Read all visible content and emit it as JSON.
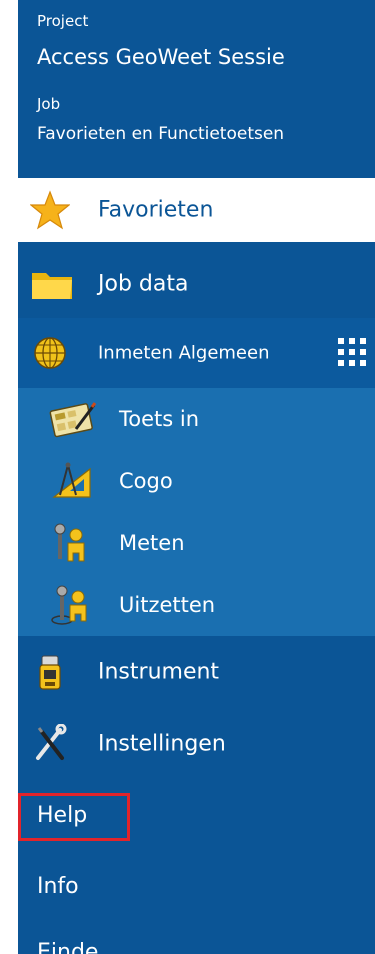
{
  "header": {
    "project_label": "Project",
    "project_value": "Access GeoWeet Sessie",
    "job_label": "Job",
    "job_value": "Favorieten en Functietoetsen"
  },
  "menu": {
    "favorieten": "Favorieten",
    "job_data": "Job data",
    "inmeten_algemeen": "Inmeten Algemeen",
    "submenu": [
      "Toets in",
      "Cogo",
      "Meten",
      "Uitzetten"
    ],
    "instrument": "Instrument",
    "instellingen": "Instellingen",
    "help": "Help",
    "info": "Info",
    "einde": "Einde"
  },
  "colors": {
    "panel_bg": "#0b5596",
    "submenu_bg": "#1a6fb0",
    "selected_bg": "#ffffff",
    "highlight_border": "#e1242b"
  },
  "icons": {
    "favorieten": "star-icon",
    "job_data": "folder-icon",
    "inmeten_algemeen": "globe-icon",
    "grid": "grid-dots-icon",
    "toets_in": "keypad-icon",
    "cogo": "cogo-compass-icon",
    "meten": "surveyor-icon",
    "uitzetten": "stakeout-icon",
    "instrument": "instrument-icon",
    "instellingen": "tools-icon"
  }
}
